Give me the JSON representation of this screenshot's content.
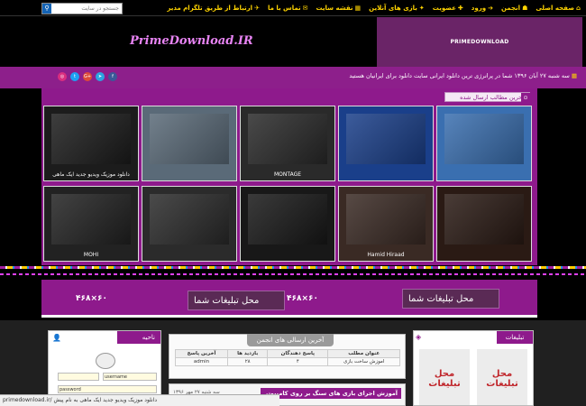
{
  "search": {
    "placeholder": "جستجو در سایت"
  },
  "nav": [
    {
      "label": "صفحه اصلی",
      "icon": "home-icon",
      "glyph": "⌂"
    },
    {
      "label": "انجمن",
      "icon": "forum-icon",
      "glyph": "☗"
    },
    {
      "label": "ورود",
      "icon": "login-icon",
      "glyph": "➔"
    },
    {
      "label": "عضویت",
      "icon": "register-icon",
      "glyph": "✚"
    },
    {
      "label": "بازی های آنلاین",
      "icon": "games-icon",
      "glyph": "✦"
    },
    {
      "label": "نقشه سایت",
      "icon": "sitemap-icon",
      "glyph": "▦"
    },
    {
      "label": "تماس با ما",
      "icon": "contact-icon",
      "glyph": "✉"
    },
    {
      "label": "ارتباط از طریق تلگرام مدیر",
      "icon": "telegram-icon",
      "glyph": "✈"
    }
  ],
  "header": {
    "logo": "PrimeDownload.IR",
    "banner": "PRIMEDOWNLOAD"
  },
  "ticker": {
    "text": "سه شنبه ۲۷ آبان ۱۳۹۶ شما در پرانرژی ترین دانلود ایرانی سایت دانلود برای ایرانیان هستید"
  },
  "social": [
    {
      "name": "instagram-icon",
      "glyph": "◎",
      "color": "#d92e7f"
    },
    {
      "name": "twitter-icon",
      "glyph": "t",
      "color": "#1da1f2"
    },
    {
      "name": "googleplus-icon",
      "glyph": "G+",
      "color": "#dd4b39"
    },
    {
      "name": "telegram-icon",
      "glyph": "➤",
      "color": "#2ca5e0"
    },
    {
      "name": "facebook-icon",
      "glyph": "f",
      "color": "#3b5998"
    }
  ],
  "gallery": {
    "title": "آخرین مطالب ارسال شده",
    "thumbs": [
      {
        "name": "thumb-desktop-software",
        "caption": "",
        "bg": "#3a6fb0"
      },
      {
        "name": "thumb-file-manager",
        "caption": "",
        "bg": "#1a3f8a"
      },
      {
        "name": "thumb-montage-film",
        "caption": "MONTAGE",
        "bg": "#2a2a2a"
      },
      {
        "name": "thumb-video-collage",
        "caption": "",
        "bg": "#5a6a78"
      },
      {
        "name": "thumb-music-video",
        "caption": "دانلود موزیک ویدیو جدید ایک ماهی",
        "bg": "#1c1c1c"
      },
      {
        "name": "thumb-singer-1",
        "caption": "",
        "bg": "#2a1a14"
      },
      {
        "name": "thumb-singer-2",
        "caption": "Hamid Hiraad",
        "bg": "#3a2a24"
      },
      {
        "name": "thumb-singer-3",
        "caption": "",
        "bg": "#181818"
      },
      {
        "name": "thumb-singer-4",
        "caption": "",
        "bg": "#2b2b2b"
      },
      {
        "name": "thumb-singer-5",
        "caption": "MOHI",
        "bg": "#222"
      }
    ]
  },
  "ads": [
    {
      "label": "محل تبلیغات شما",
      "size": "۴۶۸×۶۰"
    },
    {
      "label": "محل تبلیغات شما",
      "size": "۴۶۸×۶۰"
    }
  ],
  "user_panel": {
    "title": "ناحیه کاربری",
    "username_field": "username",
    "password_field": "password"
  },
  "forum": {
    "title": "آخرین ارسالی های انجمن",
    "headers": [
      "عنوان مطلب",
      "پاسخ دهندگان",
      "بازدید ها",
      "آخرین پاسخ"
    ],
    "rows": [
      [
        "اموزش ساخت بازی",
        "۴",
        "۲۸",
        "admin"
      ]
    ]
  },
  "post": {
    "title": "آموزش اجرای بازی های سنگ بر روی کامپیوتر",
    "date": "سه شنبه ۲۷ مهر ۱۳۹۶"
  },
  "ad_panel": {
    "title": "تبلیغات",
    "slot": "محل تبلیغات"
  },
  "status_bar": {
    "text": "primedownload.ir/ دانلود موزیک ویدیو جدید ایک ماهی به نام پیش"
  }
}
